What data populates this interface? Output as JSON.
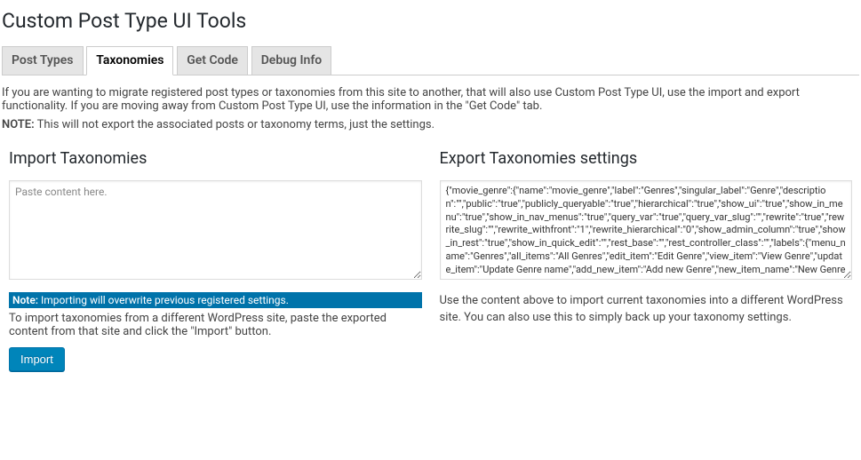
{
  "page_title": "Custom Post Type UI Tools",
  "tabs": [
    {
      "label": "Post Types"
    },
    {
      "label": "Taxonomies"
    },
    {
      "label": "Get Code"
    },
    {
      "label": "Debug Info"
    }
  ],
  "migration_note": "If you are wanting to migrate registered post types or taxonomies from this site to another, that will also use Custom Post Type UI, use the import and export functionality. If you are moving away from Custom Post Type UI, use the information in the \"Get Code\" tab.",
  "note_label": "NOTE:",
  "note_text": " This will not export the associated posts or taxonomy terms, just the settings.",
  "import": {
    "heading": "Import Taxonomies",
    "placeholder": "Paste content here.",
    "value": "",
    "warning_label": "Note:",
    "warning_text": " Importing will overwrite previous registered settings.",
    "instruction": "To import taxonomies from a different WordPress site, paste the exported content from that site and click the \"Import\" button.",
    "button_label": "Import"
  },
  "export": {
    "heading": "Export Taxonomies settings",
    "value": "{\"movie_genre\":{\"name\":\"movie_genre\",\"label\":\"Genres\",\"singular_label\":\"Genre\",\"description\":\"\",\"public\":\"true\",\"publicly_queryable\":\"true\",\"hierarchical\":\"true\",\"show_ui\":\"true\",\"show_in_menu\":\"true\",\"show_in_nav_menus\":\"true\",\"query_var\":\"true\",\"query_var_slug\":\"\",\"rewrite\":\"true\",\"rewrite_slug\":\"\",\"rewrite_withfront\":\"1\",\"rewrite_hierarchical\":\"0\",\"show_admin_column\":\"true\",\"show_in_rest\":\"true\",\"show_in_quick_edit\":\"\",\"rest_base\":\"\",\"rest_controller_class\":\"\",\"labels\":{\"menu_name\":\"Genres\",\"all_items\":\"All Genres\",\"edit_item\":\"Edit Genre\",\"view_item\":\"View Genre\",\"update_item\":\"Update Genre name\",\"add_new_item\":\"Add new Genre\",\"new_item_name\":\"New Genre name\",\"parent_item\":\"Parent Genre\",\"parent_item_colon\":\"Parent Genre:\",\"search_items\":\"Search Genres\",\"popular_items\":\"Popular Genres\",\"separate_items_with_commas\":\"Separate Genres with commas\",\"add_or_remove_items\":\"Add or remove Genres\",\"choose_from_most_used\":\"Choose from the most used Genres\",\"not_found\":\"No Genres found\",\"no_terms\":\"No Genres\",\"items_list_navigation\":\"Genres list navigation\",\"items_list\":\"Genres",
    "instruction": "Use the content above to import current taxonomies into a different WordPress site. You can also use this to simply back up your taxonomy settings."
  }
}
